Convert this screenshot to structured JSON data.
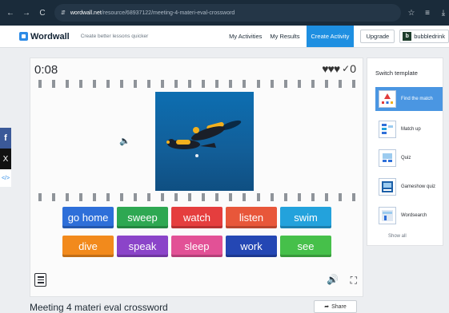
{
  "browser": {
    "back": "←",
    "forward": "→",
    "reload": "C",
    "site_settings": "⇵",
    "url_host": "wordwall.net",
    "url_path": "/resource/68937122/meeting-4-materi-eval-crossword",
    "star": "☆",
    "extensions": "≡",
    "download": "⤓"
  },
  "header": {
    "logo": "Wordwall",
    "tagline": "Create better lessons quicker",
    "my_activities": "My Activities",
    "my_results": "My Results",
    "create_activity": "Create Activity",
    "upgrade": "Upgrade",
    "user_initial": "b",
    "username": "bubbledrink"
  },
  "share_side": {
    "facebook": "f",
    "x": "X",
    "embed": "</>"
  },
  "game": {
    "timer": "0:08",
    "hearts": "♥♥♥",
    "check": "✓",
    "score": "0",
    "answers": [
      {
        "label": "go home",
        "color": "#2e6fd9"
      },
      {
        "label": "sweep",
        "color": "#2ea852"
      },
      {
        "label": "watch",
        "color": "#e53e3e"
      },
      {
        "label": "listen",
        "color": "#e8573a"
      },
      {
        "label": "swim",
        "color": "#23a2dc"
      },
      {
        "label": "dive",
        "color": "#f28a1c"
      },
      {
        "label": "speak",
        "color": "#8b44c9"
      },
      {
        "label": "sleep",
        "color": "#e25196"
      },
      {
        "label": "work",
        "color": "#2447b4"
      },
      {
        "label": "see",
        "color": "#46c04a"
      }
    ],
    "speaker_icon": "🔈",
    "sound_icon": "🔊",
    "fullscreen_icon": "⛶"
  },
  "activity": {
    "title": "Meeting 4 materi eval crossword",
    "share": "Share"
  },
  "templates": {
    "title": "Switch template",
    "items": [
      {
        "label": "Find the match",
        "selected": true
      },
      {
        "label": "Match up",
        "selected": false
      },
      {
        "label": "Quiz",
        "selected": false
      },
      {
        "label": "Gameshow quiz",
        "selected": false
      },
      {
        "label": "Wordsearch",
        "selected": false
      }
    ],
    "show_all": "Show all"
  }
}
